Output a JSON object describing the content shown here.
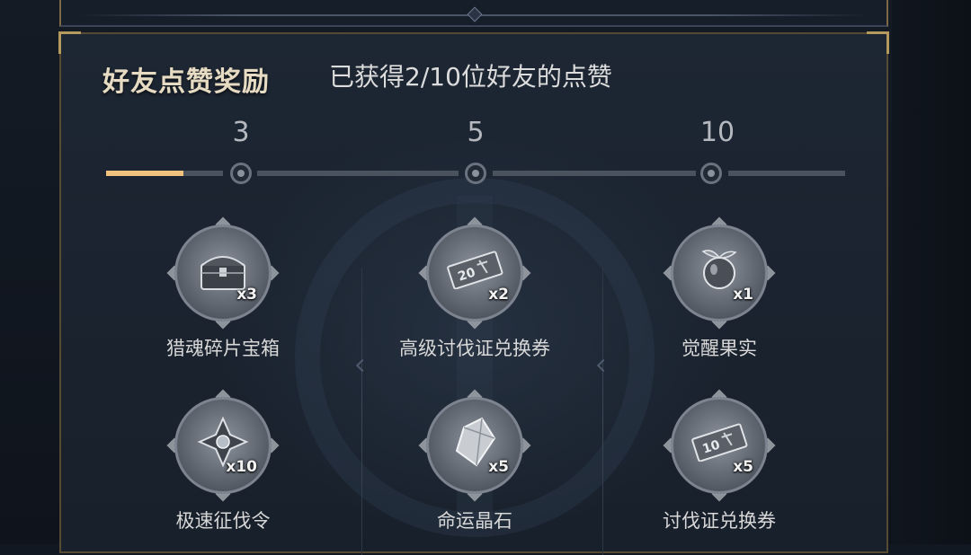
{
  "panel": {
    "title": "好友点赞奖励",
    "progress_text": "已获得2/10位好友的点赞"
  },
  "progress": {
    "current": 2,
    "max": 10,
    "fill_ratio": 0.2,
    "tiers": [
      "3",
      "5",
      "10"
    ]
  },
  "rewards": [
    {
      "name": "猎魂碎片宝箱",
      "qty": "x3",
      "icon": "treasure-chest-icon"
    },
    {
      "name": "高级讨伐证兑换券",
      "qty": "x2",
      "icon": "ticket-20-icon"
    },
    {
      "name": "觉醒果实",
      "qty": "x1",
      "icon": "fruit-icon"
    },
    {
      "name": "极速征伐令",
      "qty": "x10",
      "icon": "emblem-icon"
    },
    {
      "name": "命运晶石",
      "qty": "x5",
      "icon": "crystal-icon"
    },
    {
      "name": "讨伐证兑换券",
      "qty": "x5",
      "icon": "ticket-10-icon"
    }
  ],
  "colors": {
    "accent_gold": "#f1c27d",
    "frame_gold": "#b59a5e",
    "panel_bg": "#1d2633"
  }
}
